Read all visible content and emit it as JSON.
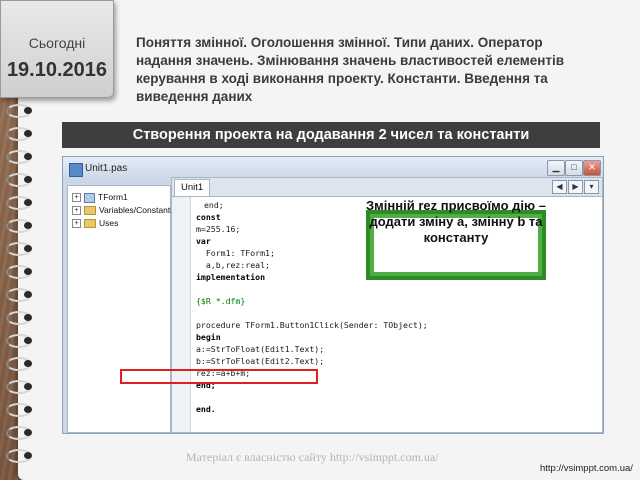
{
  "header": {
    "today_label": "Сьогодні",
    "date": "19.10.2016",
    "title": "Поняття змінної. Оголошення змінної. Типи даних. Оператор надання значень. Змінювання значень властивостей елементів керування в ході виконання проекту. Константи. Введення та виведення даних"
  },
  "banner": {
    "text": "Створення проекта на додавання 2 чисел та константи"
  },
  "ide": {
    "window_title": "Unit1.pas",
    "buttons": {
      "minimize": "▁",
      "maximize": "□",
      "close": "✕"
    },
    "tree": [
      {
        "label": "TForm1",
        "icon": "form-icon"
      },
      {
        "label": "Variables/Constants",
        "icon": "folder-icon"
      },
      {
        "label": "Uses",
        "icon": "folder-icon"
      }
    ],
    "tab": "Unit1",
    "code_lines": [
      "end;",
      "const",
      "m=255.16;",
      "var",
      "  Form1: TForm1;",
      "  a,b,rez:real;",
      "implementation",
      "",
      "{$R *.dfm}",
      "",
      "procedure TForm1.Button1Click(Sender: TObject);",
      "begin",
      "a:=StrToFloat(Edit1.Text);",
      "b:=StrToFloat(Edit2.Text);",
      "rez:=a+b+m;",
      "end;",
      "",
      "end."
    ]
  },
  "callout": {
    "text": "Змінній rez присвоїмо дію – додати зміну a, змінну b та константу"
  },
  "footer": {
    "watermark": "Матеріал є власністю сайту http://vsimppt.com.ua/",
    "site": "http://vsimppt.com.ua/"
  },
  "colors": {
    "banner_bg": "#3e3e3e",
    "callout_border": "#2f8a2a",
    "highlight_border": "#e02020"
  }
}
